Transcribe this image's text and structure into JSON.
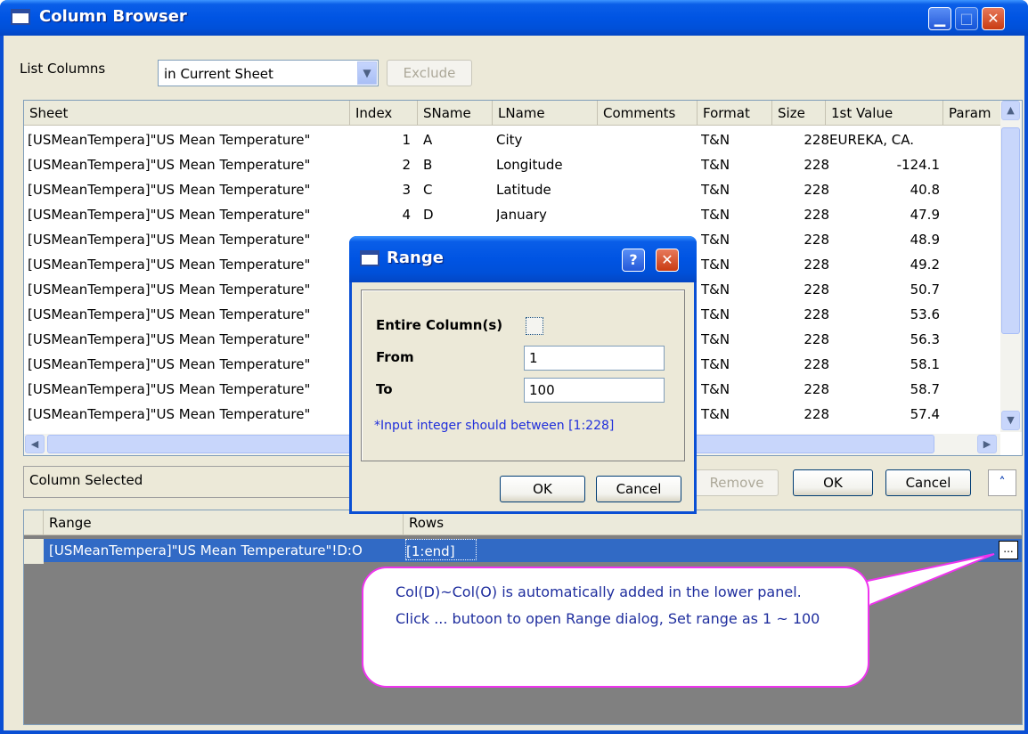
{
  "window": {
    "title": "Column Browser"
  },
  "toolbar": {
    "list_label": "List Columns",
    "combo_value": "in Current Sheet",
    "exclude_label": "Exclude"
  },
  "table": {
    "headers": [
      "Sheet",
      "Index",
      "SName",
      "LName",
      "Comments",
      "Format",
      "Size",
      "1st Value",
      "Param"
    ],
    "rows": [
      [
        "[USMeanTempera]\"US Mean Temperature\"",
        "1",
        "A",
        "City",
        "",
        "T&N",
        "228",
        "EUREKA, CA."
      ],
      [
        "[USMeanTempera]\"US Mean Temperature\"",
        "2",
        "B",
        "Longitude",
        "",
        "T&N",
        "228",
        "-124.1"
      ],
      [
        "[USMeanTempera]\"US Mean Temperature\"",
        "3",
        "C",
        "Latitude",
        "",
        "T&N",
        "228",
        "40.8"
      ],
      [
        "[USMeanTempera]\"US Mean Temperature\"",
        "4",
        "D",
        "January",
        "",
        "T&N",
        "228",
        "47.9"
      ],
      [
        "[USMeanTempera]\"US Mean Temperature\"",
        "",
        "",
        "",
        "",
        "T&N",
        "228",
        "48.9"
      ],
      [
        "[USMeanTempera]\"US Mean Temperature\"",
        "",
        "",
        "",
        "",
        "T&N",
        "228",
        "49.2"
      ],
      [
        "[USMeanTempera]\"US Mean Temperature\"",
        "",
        "",
        "",
        "",
        "T&N",
        "228",
        "50.7"
      ],
      [
        "[USMeanTempera]\"US Mean Temperature\"",
        "",
        "",
        "",
        "",
        "T&N",
        "228",
        "53.6"
      ],
      [
        "[USMeanTempera]\"US Mean Temperature\"",
        "",
        "",
        "",
        "",
        "T&N",
        "228",
        "56.3"
      ],
      [
        "[USMeanTempera]\"US Mean Temperature\"",
        "",
        "",
        "",
        "",
        "T&N",
        "228",
        "58.1"
      ],
      [
        "[USMeanTempera]\"US Mean Temperature\"",
        "",
        "",
        "",
        "",
        "T&N",
        "228",
        "58.7"
      ],
      [
        "[USMeanTempera]\"US Mean Temperature\"",
        "",
        "",
        "",
        "",
        "T&N",
        "228",
        "57.4"
      ]
    ]
  },
  "selected_panel": {
    "label": "Column Selected",
    "remove_label": "Remove",
    "ok_label": "OK",
    "cancel_label": "Cancel",
    "collapse_glyph": "˄"
  },
  "lower_grid": {
    "headers": [
      "Range",
      "Rows"
    ],
    "row": {
      "range": "[USMeanTempera]\"US Mean Temperature\"!D:O",
      "rows": "[1:end]"
    },
    "ellipsis": "..."
  },
  "callout": {
    "text": "Col(D)~Col(O) is automatically added in the lower panel. Click ... butoon to open Range dialog, Set range as 1 ~ 100"
  },
  "range_dialog": {
    "title": "Range",
    "help_glyph": "?",
    "close_glyph": "✕",
    "entire_label": "Entire Column(s)",
    "from_label": "From",
    "from_value": "1",
    "to_label": "To",
    "to_value": "100",
    "hint": "*Input integer should between [1:228]",
    "ok_label": "OK",
    "cancel_label": "Cancel"
  },
  "colors": {
    "accent": "#0054e3",
    "selection": "#316ac5",
    "callout_border": "#ee33ee",
    "hint": "#1f2edb"
  }
}
